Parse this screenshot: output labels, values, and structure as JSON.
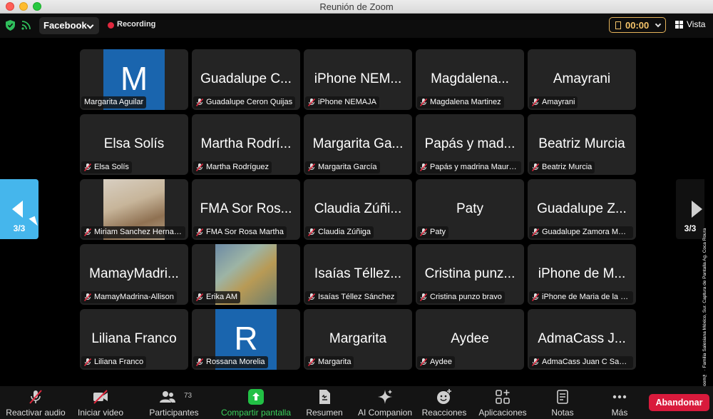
{
  "window": {
    "title": "Reunión de Zoom"
  },
  "topbar": {
    "stream_label": "Facebook",
    "recording_label": "Recording",
    "timer": "00:00",
    "view_label": "Vista"
  },
  "pager": {
    "left_count": "3/3",
    "right_count": "3/3"
  },
  "tiles": [
    {
      "big": "M",
      "tag": "Margarita Aguilar",
      "muted": false,
      "kind": "avatar"
    },
    {
      "big": "Guadalupe C...",
      "tag": "Guadalupe Ceron Quijas",
      "muted": true,
      "kind": "name"
    },
    {
      "big": "iPhone NEM...",
      "tag": "iPhone NEMAJA",
      "muted": true,
      "kind": "name"
    },
    {
      "big": "Magdalena...",
      "tag": "Magdalena Martinez",
      "muted": true,
      "kind": "name"
    },
    {
      "big": "Amayrani",
      "tag": "Amayrani",
      "muted": true,
      "kind": "name"
    },
    {
      "big": "Elsa Solís",
      "tag": "Elsa Solís",
      "muted": true,
      "kind": "name"
    },
    {
      "big": "Martha Rodrí...",
      "tag": "Martha Rodríguez",
      "muted": true,
      "kind": "name"
    },
    {
      "big": "Margarita Ga...",
      "tag": "Margarita García",
      "muted": true,
      "kind": "name"
    },
    {
      "big": "Papás y mad...",
      "tag": "Papás y madrina Mauricio",
      "muted": true,
      "kind": "name"
    },
    {
      "big": "Beatriz Murcia",
      "tag": "Beatriz Murcia",
      "muted": true,
      "kind": "name"
    },
    {
      "big": "",
      "tag": "Miriam Sanchez Hernandez",
      "muted": true,
      "kind": "saint"
    },
    {
      "big": "FMA Sor Ros...",
      "tag": "FMA Sor Rosa Martha",
      "muted": true,
      "kind": "name"
    },
    {
      "big": "Claudia Zúñi...",
      "tag": "Claudia Zúñiga",
      "muted": true,
      "kind": "name"
    },
    {
      "big": "Paty",
      "tag": "Paty",
      "muted": true,
      "kind": "name"
    },
    {
      "big": "Guadalupe Z...",
      "tag": "Guadalupe Zamora Martinez",
      "muted": true,
      "kind": "name"
    },
    {
      "big": "MamayMadri...",
      "tag": "MamayMadrina-Allison",
      "muted": true,
      "kind": "name"
    },
    {
      "big": "",
      "tag": "Erika AM",
      "muted": true,
      "kind": "painting"
    },
    {
      "big": "Isaías Téllez...",
      "tag": "Isaías Téllez Sánchez",
      "muted": true,
      "kind": "name"
    },
    {
      "big": "Cristina punz...",
      "tag": "Cristina punzo bravo",
      "muted": true,
      "kind": "name"
    },
    {
      "big": "iPhone de M...",
      "tag": "iPhone de Maria de la Luz",
      "muted": true,
      "kind": "name"
    },
    {
      "big": "Liliana Franco",
      "tag": "Liliana Franco",
      "muted": true,
      "kind": "name"
    },
    {
      "big": "R",
      "tag": "Rossana Morelia",
      "muted": true,
      "kind": "avatar"
    },
    {
      "big": "Margarita",
      "tag": "Margarita",
      "muted": true,
      "kind": "name"
    },
    {
      "big": "Aydee",
      "tag": "Aydee",
      "muted": true,
      "kind": "name"
    },
    {
      "big": "AdmaCass J...",
      "tag": "AdmaCass Juan C Santiago",
      "muted": true,
      "kind": "name"
    }
  ],
  "toolbar": {
    "unmute": "Reactivar audio",
    "start_video": "Iniciar video",
    "participants": "Participantes",
    "participants_count": "73",
    "share": "Compartir pantalla",
    "summary": "Resumen",
    "ai": "AI Companion",
    "reactions": "Reacciones",
    "apps": "Aplicaciones",
    "notes": "Notas",
    "more": "Más",
    "leave": "Abandonar"
  },
  "credit": "Cortesía © Zoom™ · Familia Salesiana México, Sur. Captura de Pantalla Ag. Coca Roura",
  "colors": {
    "share_green": "#22c045",
    "leave_red": "#d91a3c",
    "pager_blue": "#45b6ec",
    "timer_gold": "#f5c46a",
    "avatar_blue": "#1a65ae"
  }
}
